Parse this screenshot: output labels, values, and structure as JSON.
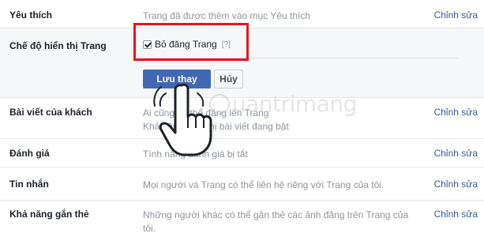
{
  "settings": {
    "rows": [
      {
        "label": "Yêu thích",
        "value": "Trang đã được thêm vào mục Yêu thích",
        "edit": "Chỉnh sửa"
      },
      {
        "label": "Bài viết của khách",
        "value": "Ai cũng có thể đăng lên Trang\nKhả năng hiển thị bài viết đang bật",
        "edit": "Chỉnh sửa"
      },
      {
        "label": "Đánh giá",
        "value": "Tính năng đánh giá bị tắt",
        "edit": "Chỉnh sửa"
      },
      {
        "label": "Tin nhắn",
        "value": "Mọi người và Trang có thể liên hệ riêng với Trang của tôi.",
        "edit": "Chỉnh sửa"
      },
      {
        "label": "Khả năng gắn thẻ",
        "value": "Những người khác có thể gắn thẻ các ảnh đăng trên Trang của tôi.",
        "edit": "Chỉnh sửa"
      }
    ],
    "expanded": {
      "label": "Chế độ hiển thị Trang",
      "checkbox_label": "Bỏ đăng Trang",
      "help": "[?]",
      "checked": true,
      "save_label": "Lưu thay đổi",
      "cancel_label": "Hủy"
    }
  },
  "watermark": {
    "text": "uantrimang"
  },
  "colors": {
    "accent": "#4267b2",
    "link": "#365899",
    "highlight": "#e8141c"
  }
}
